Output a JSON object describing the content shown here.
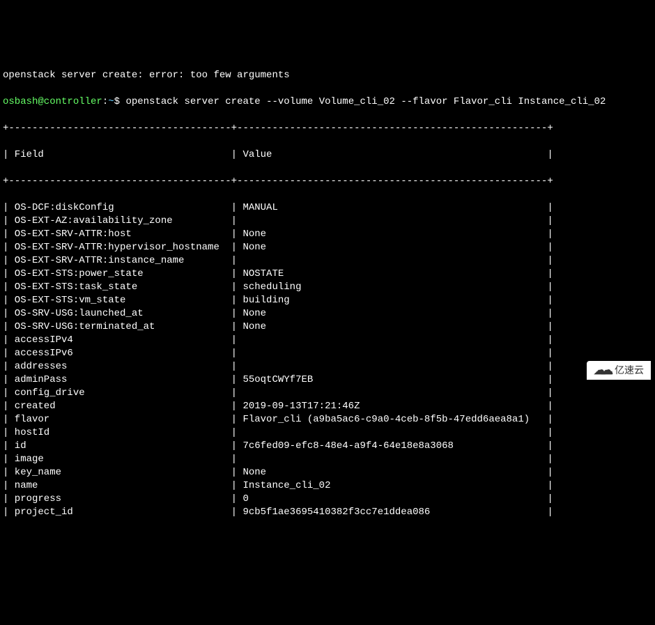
{
  "error_line": "openstack server create: error: too few arguments",
  "prompt": {
    "user_host": "osbash@controller",
    "sep1": ":",
    "path": "~",
    "sep2": "$ "
  },
  "command": "openstack server create --volume Volume_cli_02 --flavor Flavor_cli Instance_cli_02",
  "divider": "+--------------------------------------+-----------------------------------------------------+",
  "header": {
    "col1": "Field",
    "col2": "Value"
  },
  "rows": [
    {
      "f": "OS-DCF:diskConfig",
      "v": "MANUAL"
    },
    {
      "f": "OS-EXT-AZ:availability_zone",
      "v": ""
    },
    {
      "f": "OS-EXT-SRV-ATTR:host",
      "v": "None"
    },
    {
      "f": "OS-EXT-SRV-ATTR:hypervisor_hostname",
      "v": "None"
    },
    {
      "f": "OS-EXT-SRV-ATTR:instance_name",
      "v": ""
    },
    {
      "f": "OS-EXT-STS:power_state",
      "v": "NOSTATE"
    },
    {
      "f": "OS-EXT-STS:task_state",
      "v": "scheduling"
    },
    {
      "f": "OS-EXT-STS:vm_state",
      "v": "building"
    },
    {
      "f": "OS-SRV-USG:launched_at",
      "v": "None"
    },
    {
      "f": "OS-SRV-USG:terminated_at",
      "v": "None"
    },
    {
      "f": "accessIPv4",
      "v": ""
    },
    {
      "f": "accessIPv6",
      "v": ""
    },
    {
      "f": "addresses",
      "v": ""
    },
    {
      "f": "adminPass",
      "v": "55oqtCWYf7EB"
    },
    {
      "f": "config_drive",
      "v": ""
    },
    {
      "f": "created",
      "v": "2019-09-13T17:21:46Z"
    },
    {
      "f": "flavor",
      "v": "Flavor_cli (a9ba5ac6-c9a0-4ceb-8f5b-47edd6aea8a1)"
    },
    {
      "f": "hostId",
      "v": ""
    },
    {
      "f": "id",
      "v": "7c6fed09-efc8-48e4-a9f4-64e18e8a3068"
    },
    {
      "f": "image",
      "v": ""
    },
    {
      "f": "key_name",
      "v": "None"
    },
    {
      "f": "name",
      "v": "Instance_cli_02"
    },
    {
      "f": "progress",
      "v": "0"
    },
    {
      "f": "project_id",
      "v": "9cb5f1ae3695410382f3cc7e1ddea086"
    }
  ],
  "col1_width": 36,
  "col2_width": 51,
  "watermark": "亿速云"
}
